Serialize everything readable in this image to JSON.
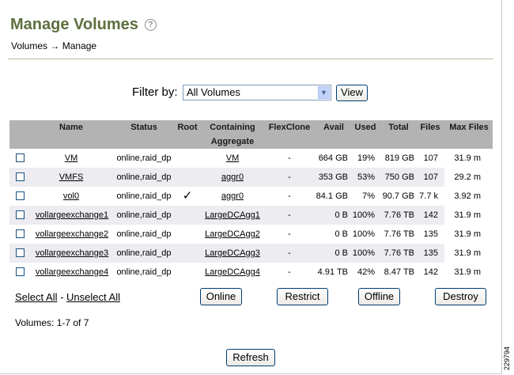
{
  "page": {
    "title": "Manage Volumes",
    "help_icon": "?",
    "breadcrumb": {
      "parent": "Volumes",
      "arrow": "→",
      "current": "Manage"
    }
  },
  "filter": {
    "label": "Filter by:",
    "selected": "All Volumes",
    "view_label": "View"
  },
  "table": {
    "headers": {
      "name": "Name",
      "status": "Status",
      "root": "Root",
      "containing_line1": "Containing",
      "containing_line2": "Aggregate",
      "flexclone": "FlexClone",
      "avail": "Avail",
      "used": "Used",
      "total": "Total",
      "files": "Files",
      "max_files": "Max Files"
    },
    "rows": [
      {
        "name": "VM",
        "status": "online,raid_dp",
        "root": "",
        "aggregate": "VM",
        "flexclone": "-",
        "avail": "664 GB",
        "used": "19%",
        "total": "819 GB",
        "files": "107",
        "max_files": "31.9 m"
      },
      {
        "name": "VMFS",
        "status": "online,raid_dp",
        "root": "",
        "aggregate": "aggr0",
        "flexclone": "-",
        "avail": "353 GB",
        "used": "53%",
        "total": "750 GB",
        "files": "107",
        "max_files": "29.2 m"
      },
      {
        "name": "vol0",
        "status": "online,raid_dp",
        "root": "✓",
        "aggregate": "aggr0",
        "flexclone": "-",
        "avail": "84.1 GB",
        "used": "7%",
        "total": "90.7 GB",
        "files": "7.7 k",
        "max_files": "3.92 m"
      },
      {
        "name": "vollargeexchange1",
        "status": "online,raid_dp",
        "root": "",
        "aggregate": "LargeDCAgg1",
        "flexclone": "-",
        "avail": "0 B",
        "used": "100%",
        "total": "7.76 TB",
        "files": "142",
        "max_files": "31.9 m"
      },
      {
        "name": "vollargeexchange2",
        "status": "online,raid_dp",
        "root": "",
        "aggregate": "LargeDCAgg2",
        "flexclone": "-",
        "avail": "0 B",
        "used": "100%",
        "total": "7.76 TB",
        "files": "135",
        "max_files": "31.9 m"
      },
      {
        "name": "vollargeexchange3",
        "status": "online,raid_dp",
        "root": "",
        "aggregate": "LargeDCAgg3",
        "flexclone": "-",
        "avail": "0 B",
        "used": "100%",
        "total": "7.76 TB",
        "files": "135",
        "max_files": "31.9 m"
      },
      {
        "name": "vollargeexchange4",
        "status": "online,raid_dp",
        "root": "",
        "aggregate": "LargeDCAgg4",
        "flexclone": "-",
        "avail": "4.91 TB",
        "used": "42%",
        "total": "8.47 TB",
        "files": "142",
        "max_files": "31.9 m"
      }
    ]
  },
  "selection": {
    "select_all": "Select All",
    "separator": " - ",
    "unselect_all": "Unselect All"
  },
  "actions": {
    "online": "Online",
    "restrict": "Restrict",
    "offline": "Offline",
    "destroy": "Destroy"
  },
  "summary": {
    "count": "Volumes: 1-7 of 7"
  },
  "refresh_label": "Refresh",
  "figure_id": "229794"
}
